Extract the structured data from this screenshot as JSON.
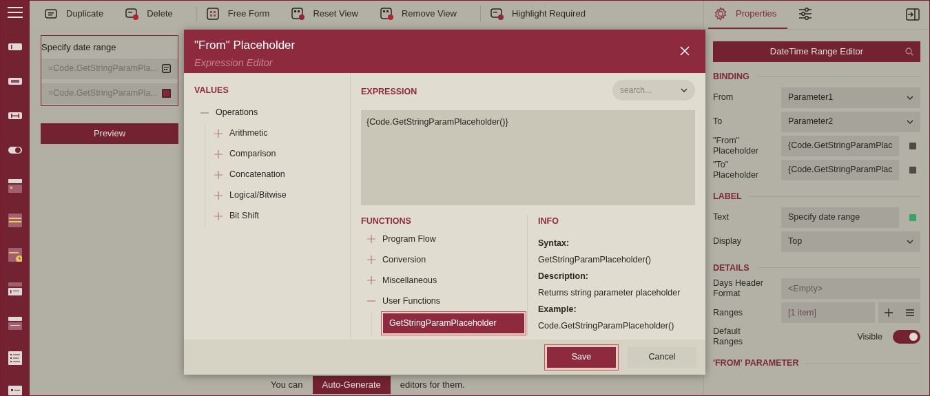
{
  "toolbar": {
    "items": [
      {
        "label": "Duplicate"
      },
      {
        "label": "Delete"
      },
      {
        "label": "Free Form"
      },
      {
        "label": "Reset View"
      },
      {
        "label": "Remove View"
      },
      {
        "label": "Highlight Required"
      }
    ]
  },
  "canvas": {
    "label": "Specify date range",
    "fields": [
      "=Code.GetStringParamPla...",
      "=Code.GetStringParamPla..."
    ],
    "preview_button": "Preview",
    "hint_before": "You can",
    "hint_button": "Auto-Generate",
    "hint_after": "editors for them."
  },
  "dialog": {
    "title": "\"From\" Placeholder",
    "subtitle": "Expression Editor",
    "values": {
      "heading": "VALUES",
      "tree": [
        {
          "label": "Operations",
          "expanded": true,
          "children": [
            {
              "label": "Arithmetic",
              "expanded": false
            },
            {
              "label": "Comparison",
              "expanded": false
            },
            {
              "label": "Concatenation",
              "expanded": false
            },
            {
              "label": "Logical/Bitwise",
              "expanded": false
            },
            {
              "label": "Bit Shift",
              "expanded": false
            }
          ]
        }
      ]
    },
    "expression": {
      "heading": "EXPRESSION",
      "search_placeholder": "search...",
      "text": "{Code.GetStringParamPlaceholder()}"
    },
    "functions": {
      "heading": "FUNCTIONS",
      "tree": [
        {
          "label": "Program Flow",
          "expanded": false
        },
        {
          "label": "Conversion",
          "expanded": false
        },
        {
          "label": "Miscellaneous",
          "expanded": false
        },
        {
          "label": "User Functions",
          "expanded": true,
          "children": [
            {
              "label": "GetStringParamPlaceholder",
              "selected": true,
              "highlighted": true
            }
          ]
        }
      ]
    },
    "info": {
      "heading": "INFO",
      "entries": [
        {
          "label": "Syntax:",
          "value": "GetStringParamPlaceholder()"
        },
        {
          "label": "Description:",
          "value": "Returns string parameter placeholder"
        },
        {
          "label": "Example:",
          "value": "Code.GetStringParamPlaceholder()"
        }
      ]
    },
    "buttons": [
      {
        "label": "Save",
        "kind": "primary",
        "highlighted": true
      },
      {
        "label": "Cancel",
        "kind": "secondary",
        "highlighted": false
      }
    ]
  },
  "properties": {
    "tabs": [
      {
        "label": "Properties",
        "selected": true
      },
      {
        "selected": false
      }
    ],
    "search_title": "DateTime Range Editor",
    "sections": [
      {
        "heading": "BINDING",
        "rows": [
          {
            "kind": "select",
            "label": "From",
            "value": "Parameter1"
          },
          {
            "kind": "select",
            "label": "To",
            "value": "Parameter2"
          },
          {
            "kind": "text",
            "label": "\"From\" Placeholder",
            "value": "{Code.GetStringParamPlac",
            "color": "#4f4a48"
          },
          {
            "kind": "text",
            "label": "\"To\" Placeholder",
            "value": "{Code.GetStringParamPlac",
            "color": "#4f4a48"
          }
        ]
      },
      {
        "heading": "LABEL",
        "rows": [
          {
            "kind": "text",
            "label": "Text",
            "value": "Specify date range",
            "color": "#3aa263"
          },
          {
            "kind": "select",
            "label": "Display",
            "value": "Top"
          }
        ]
      },
      {
        "heading": "DETAILS",
        "rows": [
          {
            "kind": "empty",
            "label": "Days Header Format",
            "placeholder": "<Empty>"
          },
          {
            "kind": "list",
            "label": "Ranges",
            "value": "[1 item]"
          },
          {
            "kind": "toggle",
            "label": "Default Ranges",
            "value": "Visible",
            "on": true
          }
        ]
      },
      {
        "heading": "'FROM' PARAMETER"
      }
    ]
  }
}
